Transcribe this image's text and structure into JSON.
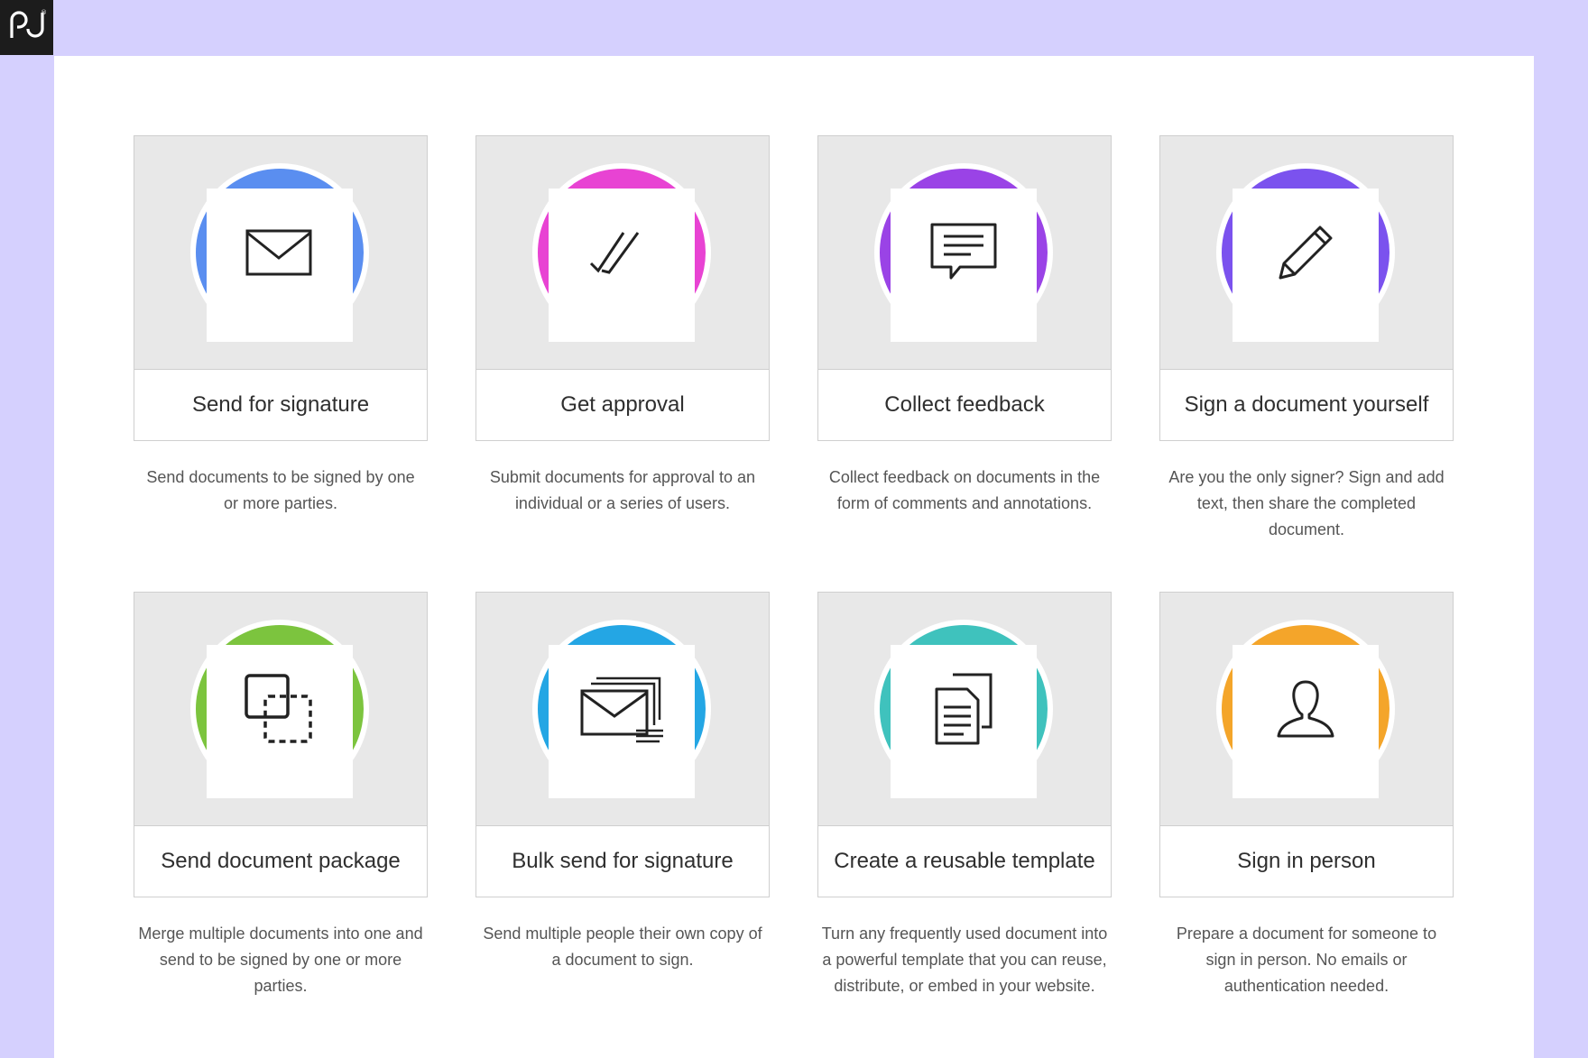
{
  "brand": {
    "logo_text": "pd",
    "logo_mark": "®"
  },
  "cards": [
    {
      "title": "Send for signature",
      "description": "Send documents to be signed by one or more parties.",
      "color": "#5a8ef0",
      "icon": "envelope-icon"
    },
    {
      "title": "Get approval",
      "description": "Submit documents for approval to an individual or a series of users.",
      "color": "#e843d3",
      "icon": "double-check-icon"
    },
    {
      "title": "Collect feedback",
      "description": "Collect feedback on documents in the form of comments and annotations.",
      "color": "#9a43e6",
      "icon": "comment-icon"
    },
    {
      "title": "Sign a document yourself",
      "description": "Are you the only signer? Sign and add text, then share the completed document.",
      "color": "#7b52ee",
      "icon": "pencil-icon"
    },
    {
      "title": "Send document package",
      "description": "Merge multiple documents into one and send to be signed by one or more parties.",
      "color": "#7cc43e",
      "icon": "package-icon"
    },
    {
      "title": "Bulk send for signature",
      "description": "Send multiple people their own copy of a document to sign.",
      "color": "#24a6e4",
      "icon": "bulk-envelope-icon"
    },
    {
      "title": "Create a reusable template",
      "description": "Turn any frequently used document into a powerful template that you can reuse, distribute, or embed in your website.",
      "color": "#3fc2bd",
      "icon": "documents-icon"
    },
    {
      "title": "Sign in person",
      "description": "Prepare a document for someone to sign in person. No emails or authentication needed.",
      "color": "#f4a52a",
      "icon": "person-icon"
    }
  ]
}
